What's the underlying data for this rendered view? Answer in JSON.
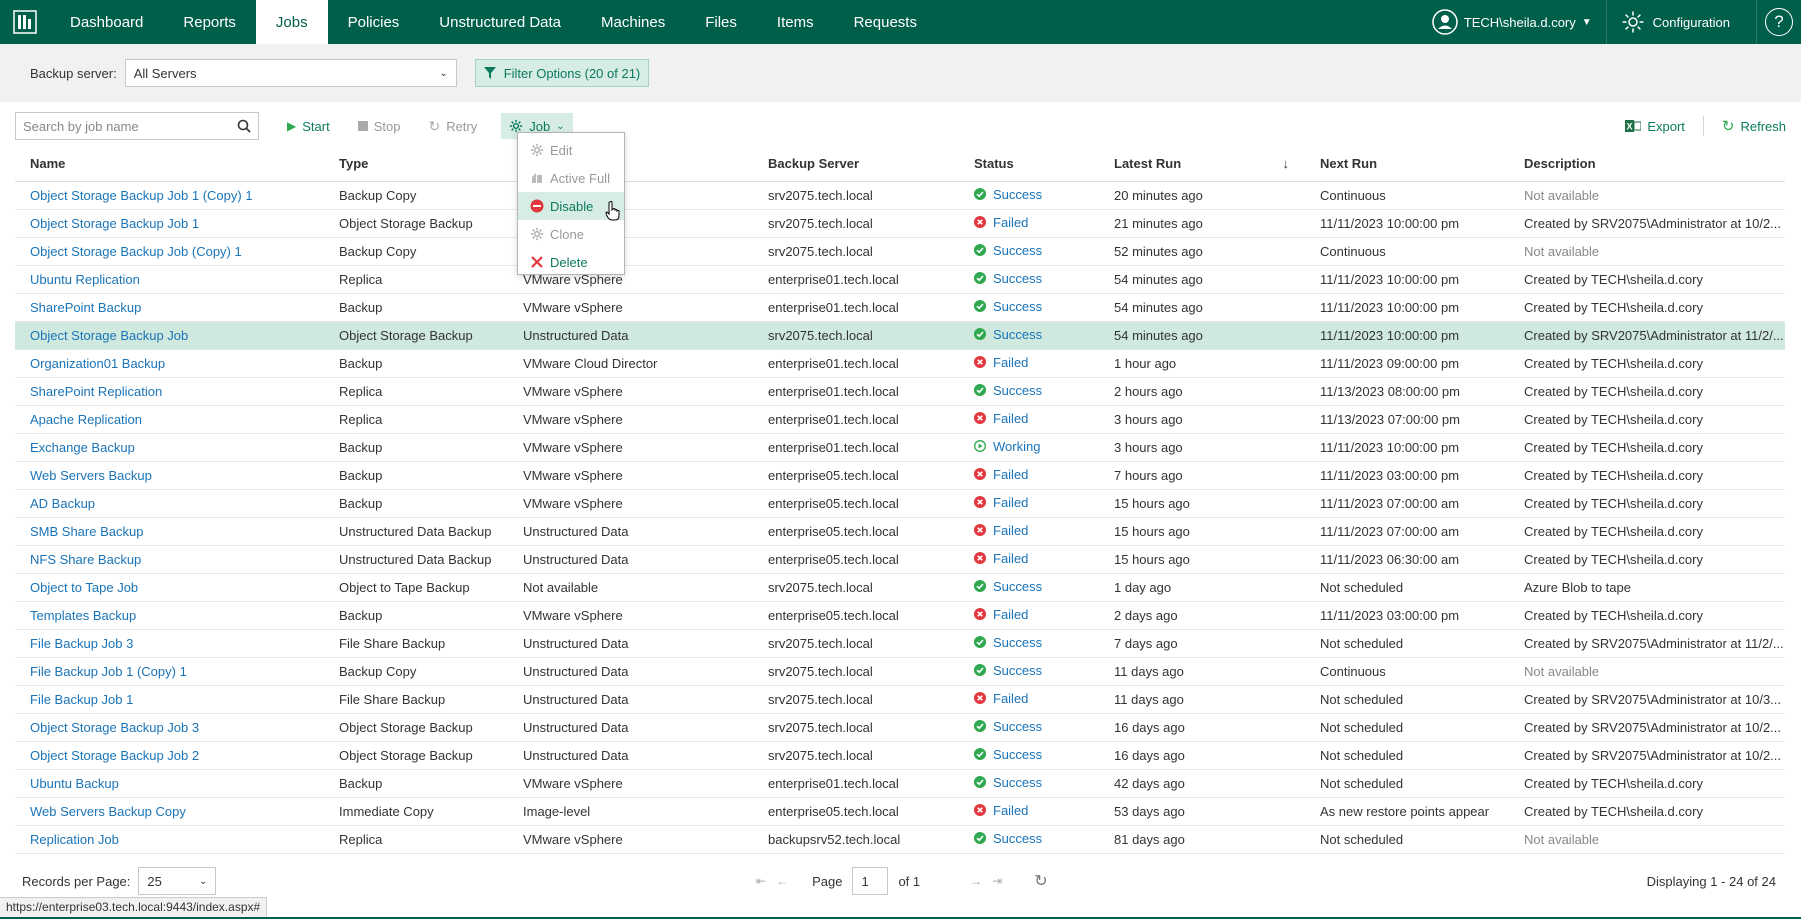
{
  "nav": {
    "items": [
      "Dashboard",
      "Reports",
      "Jobs",
      "Policies",
      "Unstructured Data",
      "Machines",
      "Files",
      "Items",
      "Requests"
    ],
    "active": "Jobs",
    "user": "TECH\\sheila.d.cory",
    "config_label": "Configuration",
    "help_label": "?"
  },
  "filter": {
    "backup_server_label": "Backup server:",
    "backup_server_value": "All Servers",
    "filter_options": "Filter Options (20 of 21)"
  },
  "toolbar": {
    "search_placeholder": "Search by job name",
    "start": "Start",
    "stop": "Stop",
    "retry": "Retry",
    "job": "Job",
    "export": "Export",
    "refresh": "Refresh"
  },
  "job_menu": {
    "edit": "Edit",
    "active_full": "Active Full",
    "disable": "Disable",
    "clone": "Clone",
    "delete": "Delete"
  },
  "table": {
    "headers": {
      "name": "Name",
      "type": "Type",
      "platform": "",
      "backup_server": "Backup Server",
      "status": "Status",
      "latest_run": "Latest Run",
      "sort_indicator": "↓",
      "next_run": "Next Run",
      "description": "Description"
    },
    "rows": [
      {
        "name": "Object Storage Backup Job 1 (Copy) 1",
        "type": "Backup Copy",
        "platform": "",
        "server": "srv2075.tech.local",
        "status": "Success",
        "latest": "20 minutes ago",
        "next": "Continuous",
        "desc": "Not available"
      },
      {
        "name": "Object Storage Backup Job 1",
        "type": "Object Storage Backup",
        "platform": "",
        "server": "srv2075.tech.local",
        "status": "Failed",
        "latest": "21 minutes ago",
        "next": "11/11/2023 10:00:00 pm",
        "desc": "Created by SRV2075\\Administrator at 10/2..."
      },
      {
        "name": "Object Storage Backup Job (Copy) 1",
        "type": "Backup Copy",
        "platform": "",
        "server": "srv2075.tech.local",
        "status": "Success",
        "latest": "52 minutes ago",
        "next": "Continuous",
        "desc": "Not available"
      },
      {
        "name": "Ubuntu Replication",
        "type": "Replica",
        "platform": "VMware vSphere",
        "server": "enterprise01.tech.local",
        "status": "Success",
        "latest": "54 minutes ago",
        "next": "11/11/2023 10:00:00 pm",
        "desc": "Created by TECH\\sheila.d.cory"
      },
      {
        "name": "SharePoint Backup",
        "type": "Backup",
        "platform": "VMware vSphere",
        "server": "enterprise01.tech.local",
        "status": "Success",
        "latest": "54 minutes ago",
        "next": "11/11/2023 10:00:00 pm",
        "desc": "Created by TECH\\sheila.d.cory"
      },
      {
        "name": "Object Storage Backup Job",
        "type": "Object Storage Backup",
        "platform": "Unstructured Data",
        "server": "srv2075.tech.local",
        "status": "Success",
        "latest": "54 minutes ago",
        "next": "11/11/2023 10:00:00 pm",
        "desc": "Created by SRV2075\\Administrator at 11/2/..."
      },
      {
        "name": "Organization01 Backup",
        "type": "Backup",
        "platform": "VMware Cloud Director",
        "server": "enterprise01.tech.local",
        "status": "Failed",
        "latest": "1 hour ago",
        "next": "11/11/2023 09:00:00 pm",
        "desc": "Created by TECH\\sheila.d.cory"
      },
      {
        "name": "SharePoint Replication",
        "type": "Replica",
        "platform": "VMware vSphere",
        "server": "enterprise01.tech.local",
        "status": "Success",
        "latest": "2 hours ago",
        "next": "11/13/2023 08:00:00 pm",
        "desc": "Created by TECH\\sheila.d.cory"
      },
      {
        "name": "Apache Replication",
        "type": "Replica",
        "platform": "VMware vSphere",
        "server": "enterprise01.tech.local",
        "status": "Failed",
        "latest": "3 hours ago",
        "next": "11/13/2023 07:00:00 pm",
        "desc": "Created by TECH\\sheila.d.cory"
      },
      {
        "name": "Exchange Backup",
        "type": "Backup",
        "platform": "VMware vSphere",
        "server": "enterprise01.tech.local",
        "status": "Working",
        "latest": "3 hours ago",
        "next": "11/11/2023 10:00:00 pm",
        "desc": "Created by TECH\\sheila.d.cory"
      },
      {
        "name": "Web Servers Backup",
        "type": "Backup",
        "platform": "VMware vSphere",
        "server": "enterprise05.tech.local",
        "status": "Failed",
        "latest": "7 hours ago",
        "next": "11/11/2023 03:00:00 pm",
        "desc": "Created by TECH\\sheila.d.cory"
      },
      {
        "name": "AD Backup",
        "type": "Backup",
        "platform": "VMware vSphere",
        "server": "enterprise05.tech.local",
        "status": "Failed",
        "latest": "15 hours ago",
        "next": "11/11/2023 07:00:00 am",
        "desc": "Created by TECH\\sheila.d.cory"
      },
      {
        "name": "SMB Share Backup",
        "type": "Unstructured Data Backup",
        "platform": "Unstructured Data",
        "server": "enterprise05.tech.local",
        "status": "Failed",
        "latest": "15 hours ago",
        "next": "11/11/2023 07:00:00 am",
        "desc": "Created by TECH\\sheila.d.cory"
      },
      {
        "name": "NFS Share Backup",
        "type": "Unstructured Data Backup",
        "platform": "Unstructured Data",
        "server": "enterprise05.tech.local",
        "status": "Failed",
        "latest": "15 hours ago",
        "next": "11/11/2023 06:30:00 am",
        "desc": "Created by TECH\\sheila.d.cory"
      },
      {
        "name": "Object to Tape Job",
        "type": "Object to Tape Backup",
        "platform": "Not available",
        "server": "srv2075.tech.local",
        "status": "Success",
        "latest": "1 day ago",
        "next": "Not scheduled",
        "desc": "Azure Blob to tape"
      },
      {
        "name": "Templates Backup",
        "type": "Backup",
        "platform": "VMware vSphere",
        "server": "enterprise05.tech.local",
        "status": "Failed",
        "latest": "2 days ago",
        "next": "11/11/2023 03:00:00 pm",
        "desc": "Created by TECH\\sheila.d.cory"
      },
      {
        "name": "File Backup Job 3",
        "type": "File Share Backup",
        "platform": "Unstructured Data",
        "server": "srv2075.tech.local",
        "status": "Success",
        "latest": "7 days ago",
        "next": "Not scheduled",
        "desc": "Created by SRV2075\\Administrator at 11/2/..."
      },
      {
        "name": "File Backup Job 1 (Copy) 1",
        "type": "Backup Copy",
        "platform": "Unstructured Data",
        "server": "srv2075.tech.local",
        "status": "Success",
        "latest": "11 days ago",
        "next": "Continuous",
        "desc": "Not available"
      },
      {
        "name": "File Backup Job 1",
        "type": "File Share Backup",
        "platform": "Unstructured Data",
        "server": "srv2075.tech.local",
        "status": "Failed",
        "latest": "11 days ago",
        "next": "Not scheduled",
        "desc": "Created by SRV2075\\Administrator at 10/3..."
      },
      {
        "name": "Object Storage Backup Job 3",
        "type": "Object Storage Backup",
        "platform": "Unstructured Data",
        "server": "srv2075.tech.local",
        "status": "Success",
        "latest": "16 days ago",
        "next": "Not scheduled",
        "desc": "Created by SRV2075\\Administrator at 10/2..."
      },
      {
        "name": "Object Storage Backup Job 2",
        "type": "Object Storage Backup",
        "platform": "Unstructured Data",
        "server": "srv2075.tech.local",
        "status": "Success",
        "latest": "16 days ago",
        "next": "Not scheduled",
        "desc": "Created by SRV2075\\Administrator at 10/2..."
      },
      {
        "name": "Ubuntu Backup",
        "type": "Backup",
        "platform": "VMware vSphere",
        "server": "enterprise01.tech.local",
        "status": "Success",
        "latest": "42 days ago",
        "next": "Not scheduled",
        "desc": "Created by TECH\\sheila.d.cory"
      },
      {
        "name": "Web Servers Backup Copy",
        "type": "Immediate Copy",
        "platform": "Image-level",
        "server": "enterprise05.tech.local",
        "status": "Failed",
        "latest": "53 days ago",
        "next": "As new restore points appear",
        "desc": "Created by TECH\\sheila.d.cory"
      },
      {
        "name": "Replication Job",
        "type": "Replica",
        "platform": "VMware vSphere",
        "server": "backupsrv52.tech.local",
        "status": "Success",
        "latest": "81 days ago",
        "next": "Not scheduled",
        "desc": "Not available"
      }
    ],
    "selected_index": 5
  },
  "footer": {
    "records_label": "Records per Page:",
    "records_value": "25",
    "page_label": "Page",
    "page_value": "1",
    "of_label": "of 1",
    "displaying": "Displaying 1 - 24 of 24"
  },
  "status_url": "https://enterprise03.tech.local:9443/index.aspx#",
  "colors": {
    "brand": "#005f4b",
    "link": "#1a74b8",
    "success": "#2fa84f",
    "failed": "#e0383e",
    "working": "#2fa84f"
  }
}
